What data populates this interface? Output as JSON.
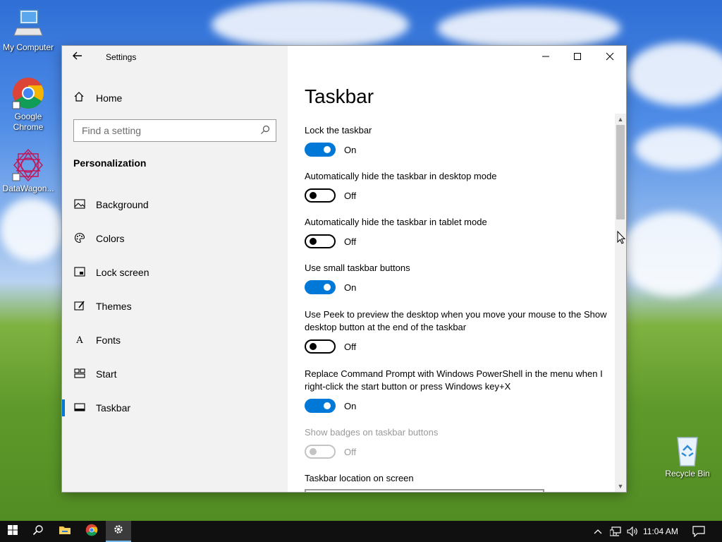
{
  "desktop": {
    "icons": [
      {
        "label": "My Computer",
        "icon": "computer-icon"
      },
      {
        "label": "Google Chrome",
        "icon": "chrome-icon"
      },
      {
        "label": "DataWagon...",
        "icon": "datawagon-icon"
      },
      {
        "label": "Recycle Bin",
        "icon": "recycle-bin-icon"
      }
    ]
  },
  "window": {
    "title": "Settings",
    "back_icon": "back-arrow-icon",
    "controls": {
      "minimize": "minimize-icon",
      "maximize": "maximize-icon",
      "close": "close-icon"
    }
  },
  "sidebar": {
    "home_label": "Home",
    "search_placeholder": "Find a setting",
    "section_label": "Personalization",
    "items": [
      {
        "label": "Background",
        "icon": "picture-icon"
      },
      {
        "label": "Colors",
        "icon": "palette-icon"
      },
      {
        "label": "Lock screen",
        "icon": "lock-screen-icon"
      },
      {
        "label": "Themes",
        "icon": "themes-icon"
      },
      {
        "label": "Fonts",
        "icon": "fonts-icon"
      },
      {
        "label": "Start",
        "icon": "start-icon"
      },
      {
        "label": "Taskbar",
        "icon": "taskbar-icon",
        "active": true
      }
    ]
  },
  "main": {
    "title": "Taskbar",
    "settings": [
      {
        "label": "Lock the taskbar",
        "state": "On",
        "on": true,
        "enabled": true
      },
      {
        "label": "Automatically hide the taskbar in desktop mode",
        "state": "Off",
        "on": false,
        "enabled": true
      },
      {
        "label": "Automatically hide the taskbar in tablet mode",
        "state": "Off",
        "on": false,
        "enabled": true
      },
      {
        "label": "Use small taskbar buttons",
        "state": "On",
        "on": true,
        "enabled": true
      },
      {
        "label": "Use Peek to preview the desktop when you move your mouse to the Show desktop button at the end of the taskbar",
        "state": "Off",
        "on": false,
        "enabled": true
      },
      {
        "label": "Replace Command Prompt with Windows PowerShell in the menu when I right-click the start button or press Windows key+X",
        "state": "On",
        "on": true,
        "enabled": true
      },
      {
        "label": "Show badges on taskbar buttons",
        "state": "Off",
        "on": false,
        "enabled": false
      }
    ],
    "location_label": "Taskbar location on screen"
  },
  "taskbar": {
    "clock": "11:04 AM",
    "colors": {
      "accent": "#0078d7",
      "bar": "#101010"
    }
  }
}
